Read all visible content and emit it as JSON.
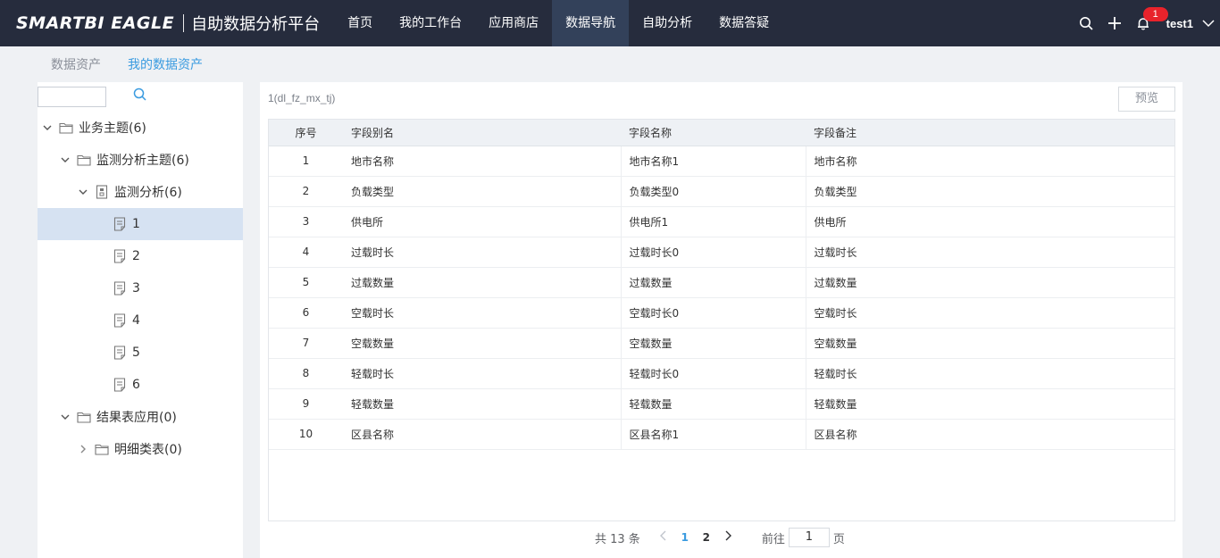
{
  "topbar": {
    "brand": "SMARTBI EAGLE",
    "subtitle": "自助数据分析平台",
    "nav": [
      "首页",
      "我的工作台",
      "应用商店",
      "数据导航",
      "自助分析",
      "数据答疑"
    ],
    "active_nav_index": 3,
    "notification_count": "1",
    "user": "test1"
  },
  "subtabs": [
    "数据资产",
    "我的数据资产"
  ],
  "tree": {
    "nodes": [
      {
        "label": "业务主题(6)",
        "level": 0,
        "expanded": true,
        "type": "folder"
      },
      {
        "label": "监测分析主题(6)",
        "level": 1,
        "expanded": true,
        "type": "folder"
      },
      {
        "label": "监测分析(6)",
        "level": 2,
        "expanded": true,
        "type": "dataset"
      },
      {
        "label": "1",
        "level": 3,
        "type": "report",
        "selected": true
      },
      {
        "label": "2",
        "level": 3,
        "type": "report"
      },
      {
        "label": "3",
        "level": 3,
        "type": "report"
      },
      {
        "label": "4",
        "level": 3,
        "type": "report"
      },
      {
        "label": "5",
        "level": 3,
        "type": "report"
      },
      {
        "label": "6",
        "level": 3,
        "type": "report"
      },
      {
        "label": "结果表应用(0)",
        "level": 1,
        "expanded": true,
        "type": "folder"
      },
      {
        "label": "明细类表(0)",
        "level": 2,
        "expanded": false,
        "type": "folder"
      }
    ]
  },
  "main": {
    "title": "1(dl_fz_mx_tj)",
    "preview_label": "预览",
    "columns": [
      "序号",
      "字段别名",
      "字段名称",
      "字段备注"
    ],
    "rows": [
      [
        "1",
        "地市名称",
        "地市名称1",
        "地市名称"
      ],
      [
        "2",
        "负载类型",
        "负载类型0",
        "负载类型"
      ],
      [
        "3",
        "供电所",
        "供电所1",
        "供电所"
      ],
      [
        "4",
        "过载时长",
        "过载时长0",
        "过载时长"
      ],
      [
        "5",
        "过载数量",
        "过载数量",
        "过载数量"
      ],
      [
        "6",
        "空载时长",
        "空载时长0",
        "空载时长"
      ],
      [
        "7",
        "空载数量",
        "空载数量",
        "空载数量"
      ],
      [
        "8",
        "轻载时长",
        "轻载时长0",
        "轻载时长"
      ],
      [
        "9",
        "轻载数量",
        "轻载数量",
        "轻载数量"
      ],
      [
        "10",
        "区县名称",
        "区县名称1",
        "区县名称"
      ]
    ]
  },
  "pager": {
    "total": "共 13 条",
    "pages": [
      "1",
      "2"
    ],
    "active_page": "1",
    "goto_label": "前往",
    "goto_value": "1",
    "page_unit": "页"
  },
  "colors": {
    "topbar_bg": "#262c3d",
    "active_nav_bg": "#33415a",
    "accent": "#3a9be0",
    "badge": "#e8232b",
    "selected_row": "#d6e2f2"
  }
}
